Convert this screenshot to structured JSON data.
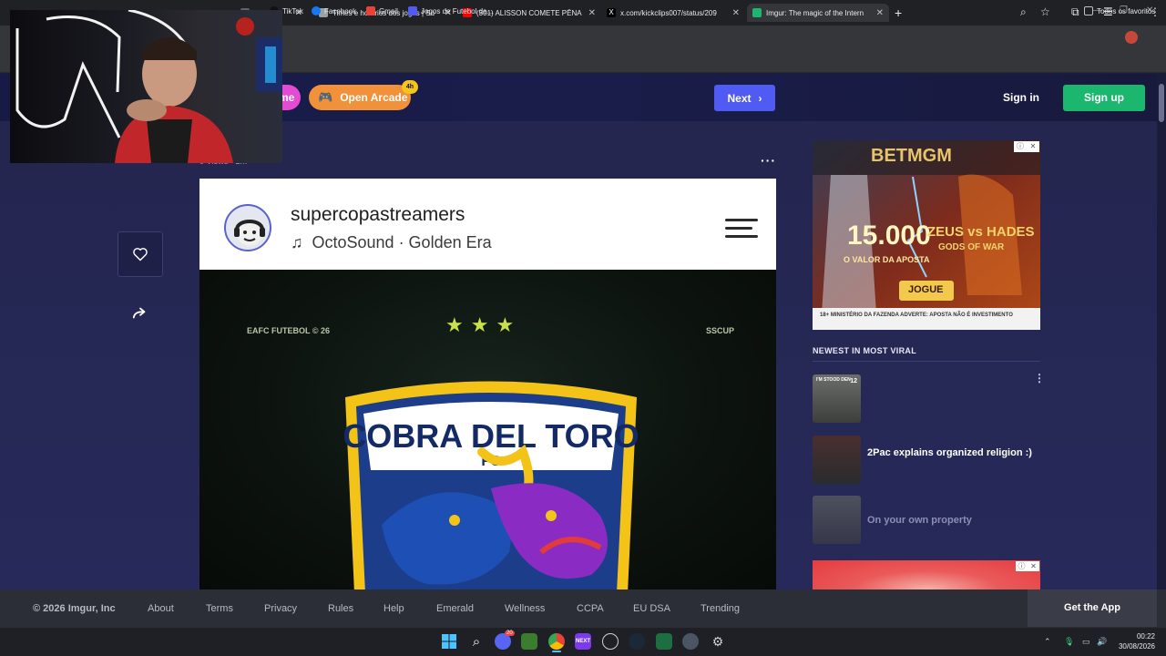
{
  "browser": {
    "tabs": [
      {
        "title": "s",
        "icon_color": "#5f6368"
      },
      {
        "title": "Times e horários dos jogos | Su",
        "icon_color": "#9aa0a6"
      },
      {
        "title": "(301) ALISSON COMETE PÊNA",
        "icon_color": "#ff0000"
      },
      {
        "title": "x.com/kickclips007/status/209",
        "icon_color": "#ffffff"
      },
      {
        "title": "Imgur: The magic of the Intern",
        "icon_color": "#1bb76e"
      }
    ],
    "new_tab": "+",
    "bookmarks": [
      {
        "label": "TikTok",
        "color": "#111111"
      },
      {
        "label": "Facebook",
        "color": "#1877f2"
      },
      {
        "label": "Gmail",
        "color": "#ea4335"
      },
      {
        "label": "Jogos de Futebol de...",
        "color": "#4f5bf2"
      }
    ],
    "all_bookmarks": "Todos os favoritos"
  },
  "header": {
    "pill_fragment": "me",
    "arcade_label": "Open Arcade",
    "arcade_badge": "4h",
    "next_label": "Next",
    "signin_label": "Sign in",
    "signup_label": "Sign up"
  },
  "post": {
    "views": "0 Views • 2m",
    "more": "···",
    "username": "supercopastreamers",
    "music": "OctoSound · Golden Era",
    "image_left_text": "EAFC FUTEBOL © 26",
    "image_right_text": "SSCUP",
    "stars": "★★★",
    "logo_title": "COBRA DEL TORO",
    "logo_sub": "FC"
  },
  "sidebar": {
    "ad_brand": "BETMGM",
    "ad_amount": "15.000",
    "ad_amount_sub": "O VALOR DA APOSTA",
    "ad_game": "ZEUS vs HADES",
    "ad_game_sub": "GODS OF WAR",
    "ad_cta": "JOGUE",
    "ad_disclaimer": "18+ MINISTÉRIO DA FAZENDA ADVERTE: APOSTA NÃO É INVESTIMENTO",
    "ad_close": [
      "ⓘ",
      "✕"
    ],
    "section_title": "NEWEST IN MOST VIRAL",
    "items": [
      {
        "title": "",
        "badge": "12",
        "thumb_text": "I'M STOOD DEN"
      },
      {
        "title": "2Pac explains organized religion :)"
      },
      {
        "title": "On your own property"
      }
    ],
    "vmore": "⋮"
  },
  "footer": {
    "copyright": "© 2026 Imgur, Inc",
    "links": [
      "About",
      "Terms",
      "Privacy",
      "Rules",
      "Help",
      "Emerald",
      "Wellness",
      "CCPA",
      "EU DSA",
      "Trending"
    ],
    "get_app": "Get the App"
  },
  "taskbar": {
    "discord_badge": "20",
    "time": "00:22",
    "date": "30/08/2026"
  }
}
